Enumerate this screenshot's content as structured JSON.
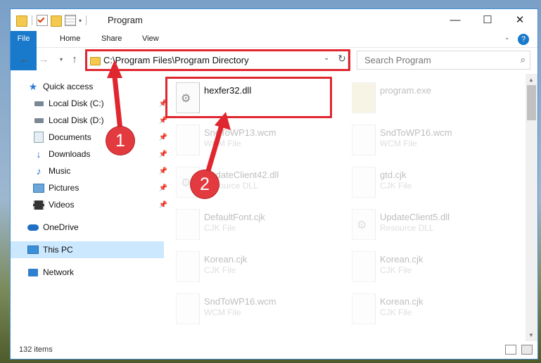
{
  "window": {
    "title": "Program",
    "controls": {
      "minimize": "—",
      "maximize": "☐",
      "close": "✕"
    }
  },
  "ribbon": {
    "tabs": [
      "File",
      "Home",
      "Share",
      "View"
    ],
    "help": "?"
  },
  "address": {
    "path": "C:\\Program Files\\Program Directory",
    "search_placeholder": "Search Program"
  },
  "sidebar": {
    "quick_access": "Quick access",
    "items": [
      {
        "label": "Local Disk (C:)",
        "icon": "drive-icon",
        "pinned": true
      },
      {
        "label": "Local Disk (D:)",
        "icon": "drive-icon",
        "pinned": true
      },
      {
        "label": "Documents",
        "icon": "documents-icon",
        "pinned": true
      },
      {
        "label": "Downloads",
        "icon": "download-arrow-icon",
        "pinned": true
      },
      {
        "label": "Music",
        "icon": "music-note-icon",
        "pinned": true
      },
      {
        "label": "Pictures",
        "icon": "pictures-icon",
        "pinned": true
      },
      {
        "label": "Videos",
        "icon": "videos-icon",
        "pinned": true
      }
    ],
    "onedrive": "OneDrive",
    "this_pc": "This PC",
    "network": "Network"
  },
  "files": [
    {
      "name": "hexfer32.dll",
      "type": "",
      "faded": false,
      "highlighted": true
    },
    {
      "name": "program.exe",
      "type": "",
      "faded": true
    },
    {
      "name": "SndToWP13.wcm",
      "type": "WCM File",
      "faded": true
    },
    {
      "name": "SndToWP16.wcm",
      "type": "WCM File",
      "faded": true
    },
    {
      "name": "UpdateClient42.dll",
      "type": "Resource DLL",
      "faded": true
    },
    {
      "name": "gtd.cjk",
      "type": "CJK File",
      "faded": true
    },
    {
      "name": "DefaultFont.cjk",
      "type": "CJK File",
      "faded": true
    },
    {
      "name": "UpdateClient5.dll",
      "type": "Resource DLL",
      "faded": true
    },
    {
      "name": "Korean.cjk",
      "type": "CJK File",
      "faded": true
    },
    {
      "name": "Korean.cjk",
      "type": "CJK File",
      "faded": true
    },
    {
      "name": "SndToWP16.wcm",
      "type": "WCM File",
      "faded": true
    },
    {
      "name": "Korean.cjk",
      "type": "CJK File",
      "faded": true
    }
  ],
  "status": {
    "item_count": "132 items"
  },
  "annotations": {
    "step1": "1",
    "step2": "2",
    "color": "#e0262f"
  }
}
